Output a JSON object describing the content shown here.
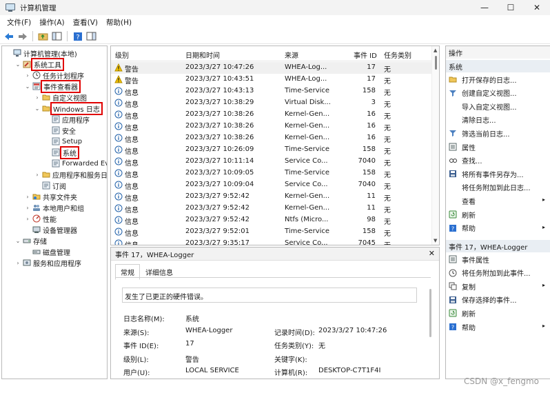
{
  "window": {
    "title": "计算机管理",
    "min": "—",
    "max": "☐",
    "close": "✕"
  },
  "menu": [
    "文件(F)",
    "操作(A)",
    "查看(V)",
    "帮助(H)"
  ],
  "tree": [
    {
      "label": "计算机管理(本地)",
      "indent": 0,
      "tw": "",
      "icon": "computer-icon"
    },
    {
      "label": "系统工具",
      "indent": 1,
      "tw": "⌄",
      "icon": "tools-icon",
      "hl": true
    },
    {
      "label": "任务计划程序",
      "indent": 2,
      "tw": "›",
      "icon": "clock-icon"
    },
    {
      "label": "事件查看器",
      "indent": 2,
      "tw": "⌄",
      "icon": "eventviewer-icon",
      "hl": true
    },
    {
      "label": "自定义视图",
      "indent": 3,
      "tw": "›",
      "icon": "folder-icon"
    },
    {
      "label": "Windows 日志",
      "indent": 3,
      "tw": "⌄",
      "icon": "folder-icon",
      "hl": true
    },
    {
      "label": "应用程序",
      "indent": 4,
      "tw": "",
      "icon": "log-icon"
    },
    {
      "label": "安全",
      "indent": 4,
      "tw": "",
      "icon": "log-icon"
    },
    {
      "label": "Setup",
      "indent": 4,
      "tw": "",
      "icon": "log-icon"
    },
    {
      "label": "系统",
      "indent": 4,
      "tw": "",
      "icon": "log-icon",
      "hl": true
    },
    {
      "label": "Forwarded Eve",
      "indent": 4,
      "tw": "",
      "icon": "log-icon"
    },
    {
      "label": "应用程序和服务日志",
      "indent": 3,
      "tw": "›",
      "icon": "folder-icon"
    },
    {
      "label": "订阅",
      "indent": 3,
      "tw": "",
      "icon": "log-icon"
    },
    {
      "label": "共享文件夹",
      "indent": 2,
      "tw": "›",
      "icon": "share-icon"
    },
    {
      "label": "本地用户和组",
      "indent": 2,
      "tw": "›",
      "icon": "users-icon"
    },
    {
      "label": "性能",
      "indent": 2,
      "tw": "›",
      "icon": "perf-icon"
    },
    {
      "label": "设备管理器",
      "indent": 2,
      "tw": "",
      "icon": "device-icon"
    },
    {
      "label": "存储",
      "indent": 1,
      "tw": "⌄",
      "icon": "storage-icon"
    },
    {
      "label": "磁盘管理",
      "indent": 2,
      "tw": "",
      "icon": "disk-icon"
    },
    {
      "label": "服务和应用程序",
      "indent": 1,
      "tw": "›",
      "icon": "services-icon"
    }
  ],
  "list": {
    "headers": [
      "级别",
      "日期和时间",
      "来源",
      "事件 ID",
      "任务类别"
    ],
    "rows": [
      {
        "level": "警告",
        "type": "warning",
        "datetime": "2023/3/27 10:47:26",
        "source": "WHEA-Log...",
        "id": "17",
        "category": "无"
      },
      {
        "level": "警告",
        "type": "warning",
        "datetime": "2023/3/27 10:43:51",
        "source": "WHEA-Log...",
        "id": "17",
        "category": "无"
      },
      {
        "level": "信息",
        "type": "info",
        "datetime": "2023/3/27 10:43:13",
        "source": "Time-Service",
        "id": "158",
        "category": "无"
      },
      {
        "level": "信息",
        "type": "info",
        "datetime": "2023/3/27 10:38:29",
        "source": "Virtual Disk...",
        "id": "3",
        "category": "无"
      },
      {
        "level": "信息",
        "type": "info",
        "datetime": "2023/3/27 10:38:26",
        "source": "Kernel-Gen...",
        "id": "16",
        "category": "无"
      },
      {
        "level": "信息",
        "type": "info",
        "datetime": "2023/3/27 10:38:26",
        "source": "Kernel-Gen...",
        "id": "16",
        "category": "无"
      },
      {
        "level": "信息",
        "type": "info",
        "datetime": "2023/3/27 10:38:26",
        "source": "Kernel-Gen...",
        "id": "16",
        "category": "无"
      },
      {
        "level": "信息",
        "type": "info",
        "datetime": "2023/3/27 10:26:09",
        "source": "Time-Service",
        "id": "158",
        "category": "无"
      },
      {
        "level": "信息",
        "type": "info",
        "datetime": "2023/3/27 10:11:14",
        "source": "Service Co...",
        "id": "7040",
        "category": "无"
      },
      {
        "level": "信息",
        "type": "info",
        "datetime": "2023/3/27 10:09:05",
        "source": "Time-Service",
        "id": "158",
        "category": "无"
      },
      {
        "level": "信息",
        "type": "info",
        "datetime": "2023/3/27 10:09:04",
        "source": "Service Co...",
        "id": "7040",
        "category": "无"
      },
      {
        "level": "信息",
        "type": "info",
        "datetime": "2023/3/27 9:52:42",
        "source": "Kernel-Gen...",
        "id": "11",
        "category": "无"
      },
      {
        "level": "信息",
        "type": "info",
        "datetime": "2023/3/27 9:52:42",
        "source": "Kernel-Gen...",
        "id": "11",
        "category": "无"
      },
      {
        "level": "信息",
        "type": "info",
        "datetime": "2023/3/27 9:52:42",
        "source": "Ntfs (Micro...",
        "id": "98",
        "category": "无"
      },
      {
        "level": "信息",
        "type": "info",
        "datetime": "2023/3/27 9:52:01",
        "source": "Time-Service",
        "id": "158",
        "category": "无"
      },
      {
        "level": "信息",
        "type": "info",
        "datetime": "2023/3/27 9:35:17",
        "source": "Service Co...",
        "id": "7045",
        "category": "无"
      }
    ]
  },
  "detail": {
    "header": "事件 17，WHEA-Logger",
    "close": "✕",
    "tabs": [
      "常规",
      "详细信息"
    ],
    "description": "发生了已更正的硬件错误。",
    "fields": {
      "log_name_label": "日志名称(M):",
      "log_name": "系统",
      "source_label": "来源(S):",
      "source": "WHEA-Logger",
      "record_time_label": "记录时间(D):",
      "record_time": "2023/3/27 10:47:26",
      "event_id_label": "事件 ID(E):",
      "event_id": "17",
      "task_label": "任务类别(Y):",
      "task": "无",
      "level_label": "级别(L):",
      "level": "警告",
      "keywords_label": "关键字(K):",
      "keywords": "",
      "user_label": "用户(U):",
      "user": "LOCAL SERVICE",
      "computer_label": "计算机(R):",
      "computer": "DESKTOP-C7T1F4I"
    }
  },
  "actions": {
    "title": "操作",
    "section1": "系统",
    "items1": [
      {
        "label": "打开保存的日志...",
        "icon": "open-folder-icon",
        "arrow": ""
      },
      {
        "label": "创建自定义视图...",
        "icon": "filter-icon",
        "arrow": ""
      },
      {
        "label": "导入自定义视图...",
        "icon": "",
        "arrow": ""
      },
      {
        "label": "清除日志...",
        "icon": "",
        "arrow": ""
      },
      {
        "label": "筛选当前日志...",
        "icon": "filter-icon",
        "arrow": ""
      },
      {
        "label": "属性",
        "icon": "properties-icon",
        "arrow": ""
      },
      {
        "label": "查找...",
        "icon": "find-icon",
        "arrow": ""
      },
      {
        "label": "将所有事件另存为...",
        "icon": "save-icon",
        "arrow": ""
      },
      {
        "label": "将任务附加到此日志...",
        "icon": "",
        "arrow": ""
      },
      {
        "label": "查看",
        "icon": "",
        "arrow": "▸"
      },
      {
        "label": "刷新",
        "icon": "refresh-icon",
        "arrow": ""
      },
      {
        "label": "帮助",
        "icon": "help-icon",
        "arrow": "▸"
      }
    ],
    "section2": "事件 17，WHEA-Logger",
    "items2": [
      {
        "label": "事件属性",
        "icon": "properties-icon",
        "arrow": ""
      },
      {
        "label": "将任务附加到此事件...",
        "icon": "task-icon",
        "arrow": ""
      },
      {
        "label": "复制",
        "icon": "copy-icon",
        "arrow": "▸"
      },
      {
        "label": "保存选择的事件...",
        "icon": "save-icon",
        "arrow": ""
      },
      {
        "label": "刷新",
        "icon": "refresh-icon",
        "arrow": ""
      },
      {
        "label": "帮助",
        "icon": "help-icon",
        "arrow": "▸"
      }
    ]
  },
  "watermark": "CSDN @x_fengmo",
  "colors": {
    "highlight": "#e00000",
    "warning": "#f2c200",
    "info": "#1f5fa8",
    "section": "#e9eef3"
  }
}
